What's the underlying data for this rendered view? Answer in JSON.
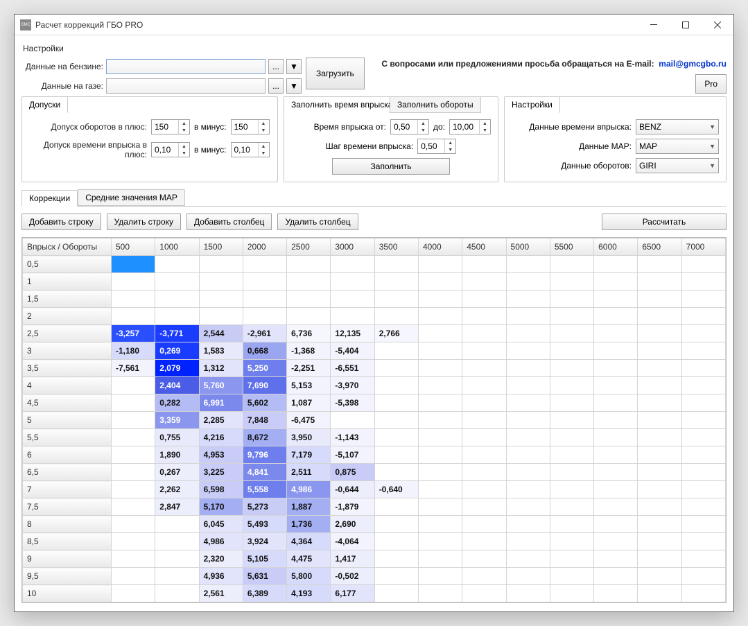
{
  "window": {
    "title": "Расчет коррекций ГБО PRO",
    "icon": "GMC"
  },
  "menu": {
    "settings": "Настройки"
  },
  "files": {
    "benzine_label": "Данные на бензине:",
    "benzine_value": "",
    "gas_label": "Данные на газе:",
    "gas_value": "",
    "browse": "...",
    "dropdown": "▼",
    "load_button": "Загрузить"
  },
  "help": {
    "text": "С вопросами или предложениями просьба обращаться на E-mail:",
    "email": "mail@gmcgbo.ru",
    "pro": "Pro"
  },
  "allowances": {
    "tab": "Допуски",
    "rpm_plus_label": "Допуск оборотов в плюс:",
    "rpm_plus": "150",
    "rpm_minus_label": "в минус:",
    "rpm_minus": "150",
    "inj_plus_label": "Допуск времени впрыска в плюс:",
    "inj_plus": "0,10",
    "inj_minus_label": "в минус:",
    "inj_minus": "0,10"
  },
  "fill": {
    "tab1": "Заполнить время впрыска",
    "tab2": "Заполнить обороты",
    "from_label": "Время впрыска от:",
    "from": "0,50",
    "to_label": "до:",
    "to": "10,00",
    "step_label": "Шаг времени впрыска:",
    "step": "0,50",
    "button": "Заполнить"
  },
  "settings_panel": {
    "tab": "Настройки",
    "inj_label": "Данные времени впрыска:",
    "inj_value": "BENZ",
    "map_label": "Данные MAP:",
    "map_value": "MAP",
    "rpm_label": "Данные оборотов:",
    "rpm_value": "GIRI"
  },
  "tabs2": {
    "t1": "Коррекции",
    "t2": "Средние значения MAP"
  },
  "toolbar": {
    "addrow": "Добавить строку",
    "delrow": "Удалить строку",
    "addcol": "Добавить столбец",
    "delcol": "Удалить столбец",
    "calc": "Рассчитать"
  },
  "grid": {
    "corner": "Впрыск / Обороты",
    "cols": [
      "500",
      "1000",
      "1500",
      "2000",
      "2500",
      "3000",
      "3500",
      "4000",
      "4500",
      "5000",
      "5500",
      "6000",
      "6500",
      "7000"
    ],
    "rows": [
      "0,5",
      "1",
      "1,5",
      "2",
      "2,5",
      "3",
      "3,5",
      "4",
      "4,5",
      "5",
      "5,5",
      "6",
      "6,5",
      "7",
      "7,5",
      "8",
      "8,5",
      "9",
      "9,5",
      "10"
    ],
    "cells": {
      "2,5": {
        "500": "-3,257",
        "1000": "-3,771",
        "1500": "2,544",
        "2000": "-2,961",
        "2500": "6,736",
        "3000": "12,135",
        "3500": "2,766"
      },
      "3": {
        "500": "-1,180",
        "1000": "0,269",
        "1500": "1,583",
        "2000": "0,668",
        "2500": "-1,368",
        "3000": "-5,404"
      },
      "3,5": {
        "500": "-7,561",
        "1000": "2,079",
        "1500": "1,312",
        "2000": "5,250",
        "2500": "-2,251",
        "3000": "-6,551"
      },
      "4": {
        "1000": "2,404",
        "1500": "5,760",
        "2000": "7,690",
        "2500": "5,153",
        "3000": "-3,970"
      },
      "4,5": {
        "1000": "0,282",
        "1500": "6,991",
        "2000": "5,602",
        "2500": "1,087",
        "3000": "-5,398"
      },
      "5": {
        "1000": "3,359",
        "1500": "2,285",
        "2000": "7,848",
        "2500": "-6,475"
      },
      "5,5": {
        "1000": "0,755",
        "1500": "4,216",
        "2000": "8,672",
        "2500": "3,950",
        "3000": "-1,143"
      },
      "6": {
        "1000": "1,890",
        "1500": "4,953",
        "2000": "9,796",
        "2500": "7,179",
        "3000": "-5,107"
      },
      "6,5": {
        "1000": "0,267",
        "1500": "3,225",
        "2000": "4,841",
        "2500": "2,511",
        "3000": "0,875"
      },
      "7": {
        "1000": "2,262",
        "1500": "6,598",
        "2000": "5,558",
        "2500": "4,986",
        "3000": "-0,644",
        "3500": "-0,640"
      },
      "7,5": {
        "1000": "2,847",
        "1500": "5,170",
        "2000": "5,273",
        "2500": "1,887",
        "3000": "-1,879"
      },
      "8": {
        "1500": "6,045",
        "2000": "5,493",
        "2500": "1,736",
        "3000": "2,690"
      },
      "8,5": {
        "1500": "4,986",
        "2000": "3,924",
        "2500": "4,364",
        "3000": "-4,064"
      },
      "9": {
        "1500": "2,320",
        "2000": "5,105",
        "2500": "4,475",
        "3000": "1,417"
      },
      "9,5": {
        "1500": "4,936",
        "2000": "5,631",
        "2500": "5,800",
        "3000": "-0,502"
      },
      "10": {
        "1500": "2,561",
        "2000": "6,389",
        "2500": "4,193",
        "3000": "6,177"
      }
    },
    "colors": {
      "2,5": {
        "500": "#2a4fff",
        "1000": "#1a3cff",
        "1500": "#c8ccf5",
        "2000": "#e2e4fb",
        "2500": "#f6f6fe",
        "3000": "#f6f6fe",
        "3500": "#f6f6fe"
      },
      "3": {
        "500": "#d7dbfb",
        "1000": "#1a3cff",
        "1500": "#e8eafc",
        "2000": "#9ba6f1",
        "2500": "#f3f3fd",
        "3000": "#f3f3fd"
      },
      "3,5": {
        "500": "#f3f3fd",
        "1000": "#0022ff",
        "1500": "#e2e4fb",
        "2000": "#6e7eec",
        "2500": "#f3f3fd",
        "3000": "#f3f3fd"
      },
      "4": {
        "1000": "#4b5de6",
        "1500": "#8b97ef",
        "2000": "#5f71ea",
        "2500": "#f3f3fd",
        "3000": "#f3f3fd"
      },
      "4,5": {
        "1000": "#b4bcf5",
        "1500": "#7b89ed",
        "2000": "#b4bcf5",
        "2500": "#f3f3fd",
        "3000": "#f3f3fd"
      },
      "5": {
        "1000": "#8b97ef",
        "1500": "#e2e4fb",
        "2000": "#c8ccf7",
        "2500": "#f3f3fd"
      },
      "5,5": {
        "1000": "#e8eafc",
        "1500": "#d7dbfb",
        "2000": "#a3aef3",
        "2500": "#e8eafc",
        "3000": "#f3f3fd"
      },
      "6": {
        "1000": "#e8eafc",
        "1500": "#c8ccf7",
        "2000": "#6e7eec",
        "2500": "#d7dbfb",
        "3000": "#f3f3fd"
      },
      "6,5": {
        "1000": "#eceefc",
        "1500": "#c8ccf7",
        "2000": "#7b89ed",
        "2500": "#d7dbfb",
        "3000": "#c8ccf7"
      },
      "7": {
        "1000": "#eceefc",
        "1500": "#c8ccf7",
        "2000": "#6e7eec",
        "2500": "#8b97ef",
        "3000": "#eceefc",
        "3500": "#f3f3fd"
      },
      "7,5": {
        "1000": "#eceefc",
        "1500": "#a3aef3",
        "2000": "#c8ccf7",
        "2500": "#a3aef3",
        "3000": "#f3f3fd"
      },
      "8": {
        "1500": "#e2e4fb",
        "2000": "#d7dbfb",
        "2500": "#a3aef3",
        "3000": "#eceefc"
      },
      "8,5": {
        "1500": "#e2e4fb",
        "2000": "#e2e4fb",
        "2500": "#d7dbfb",
        "3000": "#f3f3fd"
      },
      "9": {
        "1500": "#eceefc",
        "2000": "#d7dbfb",
        "2500": "#e2e4fb",
        "3000": "#eceefc"
      },
      "9,5": {
        "1500": "#e2e4fb",
        "2000": "#c8ccf7",
        "2500": "#d7dbfb",
        "3000": "#eceefc"
      },
      "10": {
        "1500": "#eceefc",
        "2000": "#d7dbfb",
        "2500": "#d7dbfb",
        "3000": "#e2e4fb"
      }
    },
    "textcolor": {
      "white_threshold": [
        "#2a4fff",
        "#1a3cff",
        "#0022ff",
        "#4b5de6",
        "#5f71ea",
        "#6e7eec",
        "#7b89ed",
        "#8b97ef"
      ]
    }
  }
}
